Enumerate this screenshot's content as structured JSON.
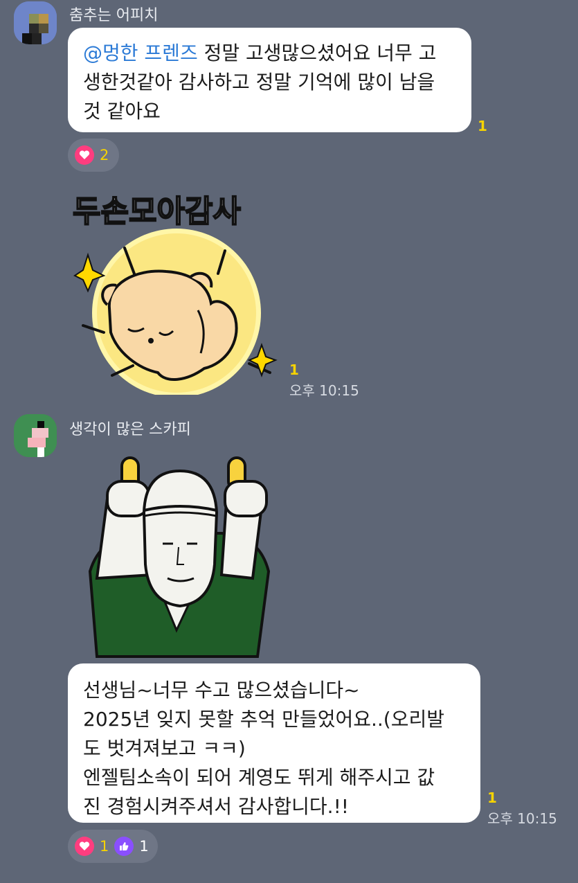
{
  "messages": [
    {
      "sender": "춤추는 어피치",
      "mention": "@멍한 프렌즈",
      "lines": [
        " 정말 고생많으셨어요 너무 고",
        "생한것같아 감사하고 정말 기억에 많이 남을",
        "것 같아요"
      ],
      "unread": "1",
      "reactions": [
        {
          "icon": "heart-icon",
          "count": "2",
          "color": "#ff3d7f"
        }
      ]
    },
    {
      "sticker_text": "두손모아감사",
      "unread": "1",
      "time": "오후 10:15"
    },
    {
      "sender": "생각이 많은 스카피"
    },
    {
      "lines": [
        "선생님~너무 수고 많으셨습니다~",
        "2025년 잊지 못할 추억 만들었어요..(오리발",
        "도 벗겨져보고 ㅋㅋ)",
        "엔젤팀소속이 되어 계영도 뛰게 해주시고 값",
        "진 경험시켜주셔서 감사합니다.!!"
      ],
      "unread": "1",
      "time": "오후 10:15",
      "reactions": [
        {
          "icon": "heart-icon",
          "count": "1",
          "color": "#ff3d7f"
        },
        {
          "icon": "thumbs-up-icon",
          "count": "1",
          "color": "#8a4fff"
        }
      ]
    }
  ],
  "colors": {
    "background": "#5e6676",
    "unread": "#f6d300",
    "mention": "#2b7ad6"
  }
}
